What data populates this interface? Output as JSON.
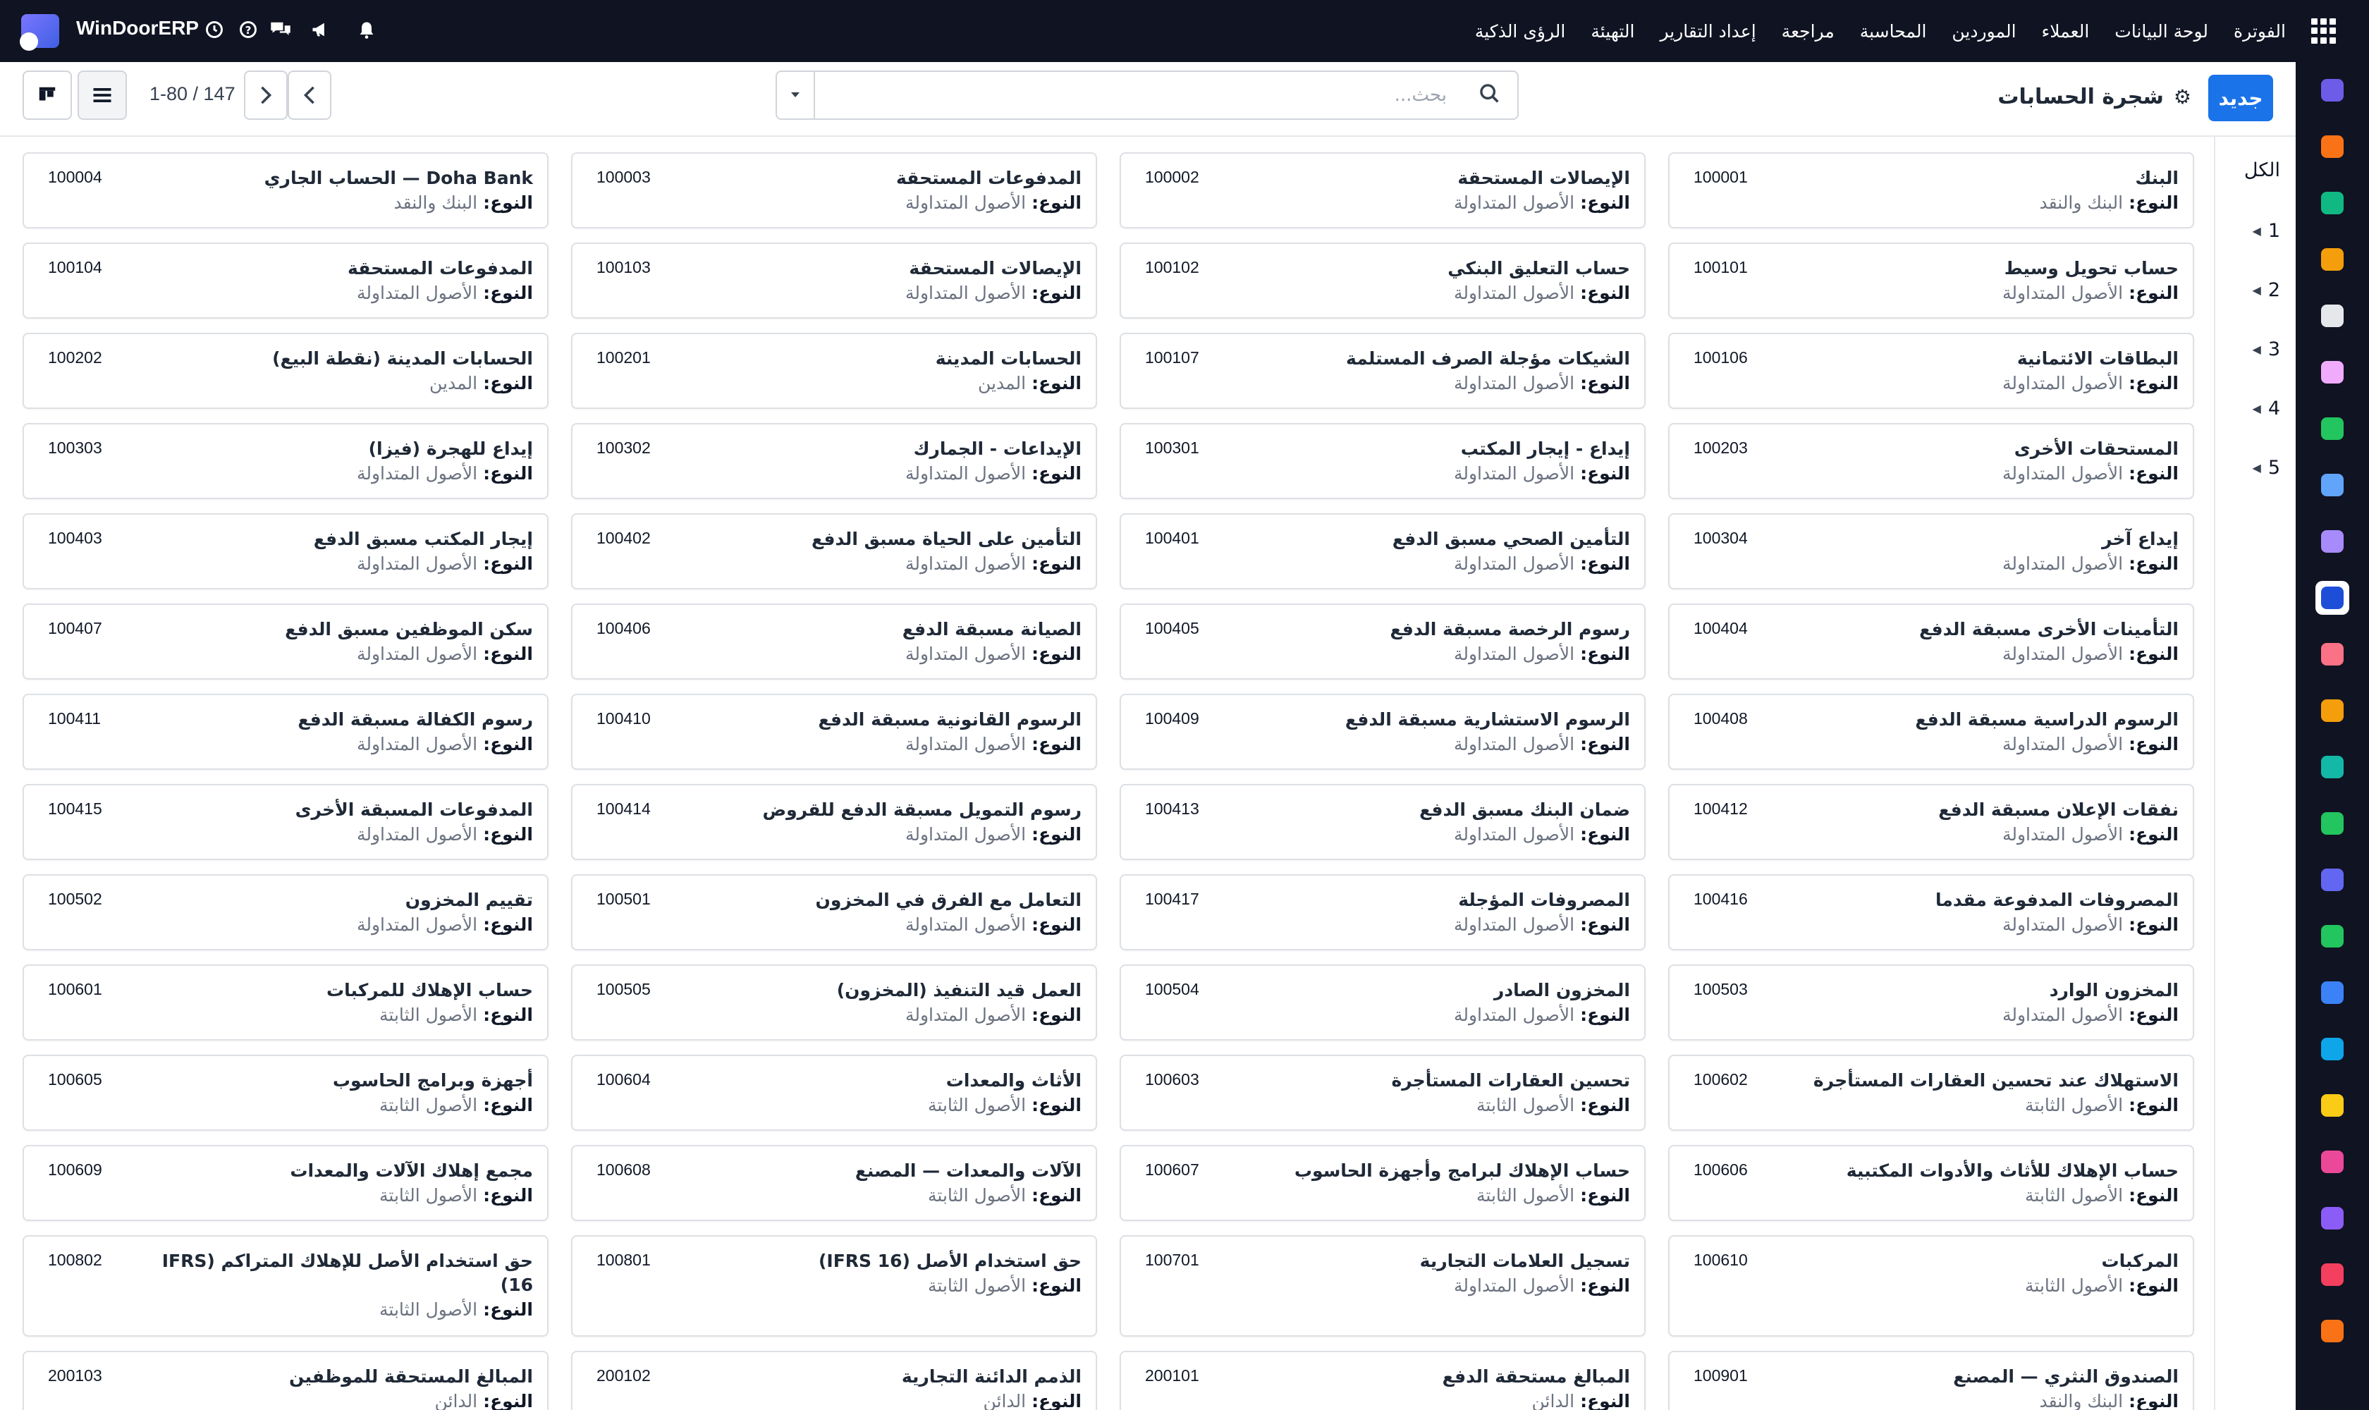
{
  "topbar": {
    "brand": "WinDoorERP",
    "menu": [
      "الفوترة",
      "لوحة البيانات",
      "العملاء",
      "الموردين",
      "المحاسبة",
      "مراجعة",
      "إعداد التقارير",
      "التهيئة",
      "الرؤى الذكية"
    ],
    "icons": [
      "apps-grid-icon",
      "clock-icon",
      "help-icon",
      "chat-icon",
      "megaphone-icon",
      "bell-icon"
    ]
  },
  "control": {
    "new_label": "جديد",
    "title": "شجرة الحسابات",
    "search_placeholder": "بحث...",
    "pager": "1-80 / 147"
  },
  "levels": [
    "الكل",
    "1",
    "2",
    "3",
    "4",
    "5"
  ],
  "type_label": "النوع:",
  "cards": [
    {
      "name": "البنك",
      "code": "100001",
      "type": "البنك والنقد"
    },
    {
      "name": "الإيصالات المستحقة",
      "code": "100002",
      "type": "الأصول المتداولة"
    },
    {
      "name": "المدفوعات المستحقة",
      "code": "100003",
      "type": "الأصول المتداولة"
    },
    {
      "name": "Doha Bank — الحساب الجاري",
      "code": "100004",
      "type": "البنك والنقد"
    },
    {
      "name": "حساب تحويل وسيط",
      "code": "100101",
      "type": "الأصول المتداولة"
    },
    {
      "name": "حساب التعليق البنكي",
      "code": "100102",
      "type": "الأصول المتداولة"
    },
    {
      "name": "الإيصالات المستحقة",
      "code": "100103",
      "type": "الأصول المتداولة"
    },
    {
      "name": "المدفوعات المستحقة",
      "code": "100104",
      "type": "الأصول المتداولة"
    },
    {
      "name": "البطاقات الائتمانية",
      "code": "100106",
      "type": "الأصول المتداولة"
    },
    {
      "name": "الشيكات مؤجلة الصرف المستلمة",
      "code": "100107",
      "type": "الأصول المتداولة"
    },
    {
      "name": "الحسابات المدينة",
      "code": "100201",
      "type": "المدين"
    },
    {
      "name": "الحسابات المدينة (نقطة البيع)",
      "code": "100202",
      "type": "المدين"
    },
    {
      "name": "المستحقات الأخرى",
      "code": "100203",
      "type": "الأصول المتداولة"
    },
    {
      "name": "إيداع - إيجار المكتب",
      "code": "100301",
      "type": "الأصول المتداولة"
    },
    {
      "name": "الإيداعات - الجمارك",
      "code": "100302",
      "type": "الأصول المتداولة"
    },
    {
      "name": "إيداع للهجرة (فيزا)",
      "code": "100303",
      "type": "الأصول المتداولة"
    },
    {
      "name": "إيداع آخر",
      "code": "100304",
      "type": "الأصول المتداولة"
    },
    {
      "name": "التأمين الصحي مسبق الدفع",
      "code": "100401",
      "type": "الأصول المتداولة"
    },
    {
      "name": "التأمين على الحياة مسبق الدفع",
      "code": "100402",
      "type": "الأصول المتداولة"
    },
    {
      "name": "إيجار المكتب مسبق الدفع",
      "code": "100403",
      "type": "الأصول المتداولة"
    },
    {
      "name": "التأمينات الأخرى مسبقة الدفع",
      "code": "100404",
      "type": "الأصول المتداولة"
    },
    {
      "name": "رسوم الرخصة مسبقة الدفع",
      "code": "100405",
      "type": "الأصول المتداولة"
    },
    {
      "name": "الصيانة مسبقة الدفع",
      "code": "100406",
      "type": "الأصول المتداولة"
    },
    {
      "name": "سكن الموظفين مسبق الدفع",
      "code": "100407",
      "type": "الأصول المتداولة"
    },
    {
      "name": "الرسوم الدراسية مسبقة الدفع",
      "code": "100408",
      "type": "الأصول المتداولة"
    },
    {
      "name": "الرسوم الاستشارية مسبقة الدفع",
      "code": "100409",
      "type": "الأصول المتداولة"
    },
    {
      "name": "الرسوم القانونية مسبقة الدفع",
      "code": "100410",
      "type": "الأصول المتداولة"
    },
    {
      "name": "رسوم الكفالة مسبقة الدفع",
      "code": "100411",
      "type": "الأصول المتداولة"
    },
    {
      "name": "نفقات الإعلان مسبقة الدفع",
      "code": "100412",
      "type": "الأصول المتداولة"
    },
    {
      "name": "ضمان البنك مسبق الدفع",
      "code": "100413",
      "type": "الأصول المتداولة"
    },
    {
      "name": "رسوم التمويل مسبقة الدفع للقروض",
      "code": "100414",
      "type": "الأصول المتداولة"
    },
    {
      "name": "المدفوعات المسبقة الأخرى",
      "code": "100415",
      "type": "الأصول المتداولة"
    },
    {
      "name": "المصروفات المدفوعة مقدما",
      "code": "100416",
      "type": "الأصول المتداولة"
    },
    {
      "name": "المصروفات المؤجلة",
      "code": "100417",
      "type": "الأصول المتداولة"
    },
    {
      "name": "التعامل مع الفرق في المخزون",
      "code": "100501",
      "type": "الأصول المتداولة"
    },
    {
      "name": "تقييم المخزون",
      "code": "100502",
      "type": "الأصول المتداولة"
    },
    {
      "name": "المخزون الوارد",
      "code": "100503",
      "type": "الأصول المتداولة"
    },
    {
      "name": "المخزون الصادر",
      "code": "100504",
      "type": "الأصول المتداولة"
    },
    {
      "name": "العمل قيد التنفيذ (المخزون)",
      "code": "100505",
      "type": "الأصول المتداولة"
    },
    {
      "name": "حساب الإهلاك للمركبات",
      "code": "100601",
      "type": "الأصول الثابتة"
    },
    {
      "name": "الاستهلاك عند تحسين العقارات المستأجرة",
      "code": "100602",
      "type": "الأصول الثابتة"
    },
    {
      "name": "تحسين العقارات المستأجرة",
      "code": "100603",
      "type": "الأصول الثابتة"
    },
    {
      "name": "الأثاث والمعدات",
      "code": "100604",
      "type": "الأصول الثابتة"
    },
    {
      "name": "أجهزة وبرامج الحاسوب",
      "code": "100605",
      "type": "الأصول الثابتة"
    },
    {
      "name": "حساب الإهلاك للأثاث والأدوات المكتبية",
      "code": "100606",
      "type": "الأصول الثابتة"
    },
    {
      "name": "حساب الإهلاك لبرامج وأجهزة الحاسوب",
      "code": "100607",
      "type": "الأصول الثابتة"
    },
    {
      "name": "الآلات والمعدات — المصنع",
      "code": "100608",
      "type": "الأصول الثابتة"
    },
    {
      "name": "مجمع إهلاك الآلات والمعدات",
      "code": "100609",
      "type": "الأصول الثابتة"
    },
    {
      "name": "المركبات",
      "code": "100610",
      "type": "الأصول الثابتة"
    },
    {
      "name": "تسجيل العلامات التجارية",
      "code": "100701",
      "type": "الأصول المتداولة"
    },
    {
      "name": "حق استخدام الأصل (IFRS 16)",
      "code": "100801",
      "type": "الأصول الثابتة"
    },
    {
      "name": "حق استخدام الأصل للإهلاك المتراكم (IFRS 16)",
      "code": "100802",
      "type": "الأصول الثابتة"
    },
    {
      "name": "الصندوق النثري — المصنع",
      "code": "100901",
      "type": "البنك والنقد"
    },
    {
      "name": "المبالغ مستحقة الدفع",
      "code": "200101",
      "type": "الدائن"
    },
    {
      "name": "الذمم الدائنة التجارية",
      "code": "200102",
      "type": "الدائن"
    },
    {
      "name": "المبالغ المستحقة للموظفين",
      "code": "200103",
      "type": "الدائن"
    }
  ],
  "rail_apps": [
    {
      "name": "mail-app-icon",
      "color": "#6c5ce7"
    },
    {
      "name": "discuss-app-icon",
      "color": "#f97316"
    },
    {
      "name": "crm-app-icon",
      "color": "#10b981"
    },
    {
      "name": "reports-app-icon",
      "color": "#f59e0b"
    },
    {
      "name": "inventory-app-icon",
      "color": "#e5e7eb"
    },
    {
      "name": "contacts-app-icon",
      "color": "#f0abfc"
    },
    {
      "name": "tasks-app-icon",
      "color": "#22c55e"
    },
    {
      "name": "knowledge-app-icon",
      "color": "#60a5fa"
    },
    {
      "name": "package-app-icon",
      "color": "#a78bfa"
    },
    {
      "name": "accounting-app-icon",
      "color": "#1d4ed8"
    },
    {
      "name": "employees-app-icon",
      "color": "#fb7185"
    },
    {
      "name": "calendar-app-icon",
      "color": "#f59e0b"
    },
    {
      "name": "sign-app-icon",
      "color": "#14b8a6"
    },
    {
      "name": "members-app-icon",
      "color": "#22c55e"
    },
    {
      "name": "dashboard-app-icon",
      "color": "#6366f1"
    },
    {
      "name": "whatsapp-app-icon",
      "color": "#22c55e"
    },
    {
      "name": "time-app-icon",
      "color": "#3b82f6"
    },
    {
      "name": "website-app-icon",
      "color": "#0ea5e9"
    },
    {
      "name": "telegram-app-icon",
      "color": "#facc15"
    },
    {
      "name": "spreadsheet-app-icon",
      "color": "#ec4899"
    },
    {
      "name": "modules-app-icon",
      "color": "#8b5cf6"
    },
    {
      "name": "planning-app-icon",
      "color": "#f43f5e"
    },
    {
      "name": "studio-app-icon",
      "color": "#f97316"
    }
  ]
}
